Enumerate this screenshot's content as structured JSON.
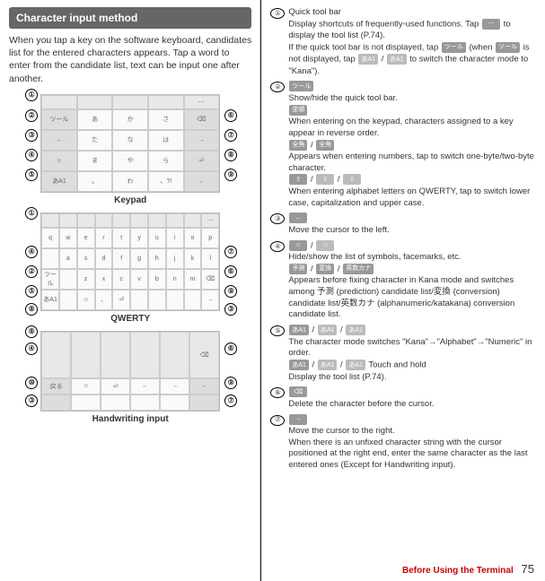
{
  "header": "Character input method",
  "intro": "When you tap a key on the software keyboard, candidates list for the entered characters appears. Tap a word to enter from the candidate list, text can be input one after another.",
  "captions": {
    "keypad": "Keypad",
    "qwerty": "QWERTY",
    "hand": "Handwriting input"
  },
  "keypad_rows": [
    [
      "",
      "",
      "",
      "",
      "⋯"
    ],
    [
      "ツール",
      "あ",
      "か",
      "さ",
      "⌫"
    ],
    [
      "←",
      "た",
      "な",
      "は",
      "→"
    ],
    [
      "☺",
      "ま",
      "や",
      "ら",
      "⏎"
    ],
    [
      "あA1",
      "。",
      "わ",
      "、?!",
      "←"
    ]
  ],
  "qwerty_rows": [
    [
      "",
      "",
      "",
      "",
      "",
      "",
      "",
      "",
      "",
      "⋯"
    ],
    [
      "q",
      "w",
      "e",
      "r",
      "t",
      "y",
      "u",
      "i",
      "o",
      "p"
    ],
    [
      "",
      "a",
      "s",
      "d",
      "f",
      "g",
      "h",
      "j",
      "k",
      "l"
    ],
    [
      "ツール",
      "",
      "z",
      "x",
      "c",
      "v",
      "b",
      "n",
      "m",
      "⌫"
    ],
    [
      "あA1",
      "",
      "☺",
      "、",
      "⏎",
      "",
      "",
      "",
      "",
      "→"
    ]
  ],
  "hand_rows": [
    [
      "",
      "",
      "",
      "",
      "",
      "⌫"
    ],
    [
      "戻る",
      "☺",
      "⏎",
      "←",
      "→",
      "←"
    ],
    [
      "",
      "",
      "",
      "",
      "",
      ""
    ]
  ],
  "items": [
    {
      "n": "①",
      "title": "Quick tool bar",
      "body": "Display shortcuts of frequently-used functions. Tap ",
      "body2": " to display the tool list (P.74).",
      "extra": "If the quick tool bar is not displayed, tap ",
      "extra2": " (when ",
      "extra3": " is not displayed, tap ",
      "extra4": " / ",
      "extra5": " to switch the character mode to \"Kana\").",
      "c1": "⋯",
      "c2": "ツール",
      "c3": "ツール",
      "c4": "あA1",
      "c5": "あA1"
    },
    {
      "n": "②",
      "title": "",
      "chip": "ツール",
      "body": "Show/hide the quick tool bar.",
      "chip2": "逆順",
      "body2": "When entering on the keypad, characters assigned to a key appear in reverse order.",
      "chip3": "全角",
      "sep": " / ",
      "chip4": "全角",
      "body3": "Appears when entering numbers, tap to switch one-byte/two-byte character.",
      "chip5": "⇧",
      "chip6": "⇧",
      "chip7": "⇧",
      "body4": "When entering alphabet letters on QWERTY, tap to switch lower case, capitalization and upper case."
    },
    {
      "n": "③",
      "chip": "←",
      "body": "Move the cursor to the left."
    },
    {
      "n": "④",
      "chip": "☺",
      "sep": " / ",
      "chip2": "☺",
      "body": "Hide/show the list of symbols, facemarks, etc.",
      "chip3": "予測",
      "chip4": "変換",
      "chip5": "英数カナ",
      "body2": "Appears before fixing character in Kana mode and switches among 予測 (prediction) candidate list/変換 (conversion) candidate list/英数カナ (alphanumeric/katakana) conversion candidate list."
    },
    {
      "n": "⑤",
      "chip": "あA1",
      "chip2": "あA1",
      "chip3": "あA1",
      "body": "The character mode switches \"Kana\"→\"Alphabet\"→\"Numeric\" in order.",
      "chip4": "あA1",
      "chip5": "あA1",
      "chip6": "あA1",
      "body2": " Touch and hold",
      "body3": "Display the tool list (P.74)."
    },
    {
      "n": "⑥",
      "chip": "⌫",
      "body": "Delete the character before the cursor."
    },
    {
      "n": "⑦",
      "chip": "→",
      "body": "Move the cursor to the right.",
      "body2": "When there is an unfixed character string with the cursor positioned at the right end, enter the same character as the last entered ones (Except for Handwriting input)."
    }
  ],
  "footer": {
    "section": "Before Using the Terminal",
    "page": "75"
  },
  "callouts_keypad": [
    {
      "n": "①",
      "t": -7,
      "l": -18
    },
    {
      "n": "②",
      "t": 16,
      "l": -18
    },
    {
      "n": "③",
      "t": 38,
      "l": -18
    },
    {
      "n": "④",
      "t": 60,
      "l": -18
    },
    {
      "n": "⑤",
      "t": 82,
      "l": -18
    },
    {
      "n": "⑥",
      "t": 16,
      "l": 204
    },
    {
      "n": "⑦",
      "t": 38,
      "l": 204
    },
    {
      "n": "⑧",
      "t": 60,
      "l": 204
    },
    {
      "n": "⑨",
      "t": 82,
      "l": 204
    }
  ],
  "callouts_qwerty": [
    {
      "n": "①",
      "t": -7,
      "l": -18
    },
    {
      "n": "④",
      "t": 36,
      "l": -18
    },
    {
      "n": "②",
      "t": 58,
      "l": -18
    },
    {
      "n": "⑤",
      "t": 80,
      "l": -18
    },
    {
      "n": "⑧",
      "t": 100,
      "l": -18
    },
    {
      "n": "⑦",
      "t": 36,
      "l": 204
    },
    {
      "n": "⑥",
      "t": 58,
      "l": 204
    },
    {
      "n": "⑨",
      "t": 80,
      "l": 204
    },
    {
      "n": "③",
      "t": 100,
      "l": 204
    }
  ],
  "callouts_hand": [
    {
      "n": "⑧",
      "t": -7,
      "l": -18
    },
    {
      "n": "④",
      "t": 12,
      "l": -18
    },
    {
      "n": "⑩",
      "t": 50,
      "l": -18
    },
    {
      "n": "③",
      "t": 70,
      "l": -18
    },
    {
      "n": "⑥",
      "t": 12,
      "l": 204
    },
    {
      "n": "⑨",
      "t": 50,
      "l": 204
    },
    {
      "n": "⑦",
      "t": 70,
      "l": 204
    }
  ]
}
